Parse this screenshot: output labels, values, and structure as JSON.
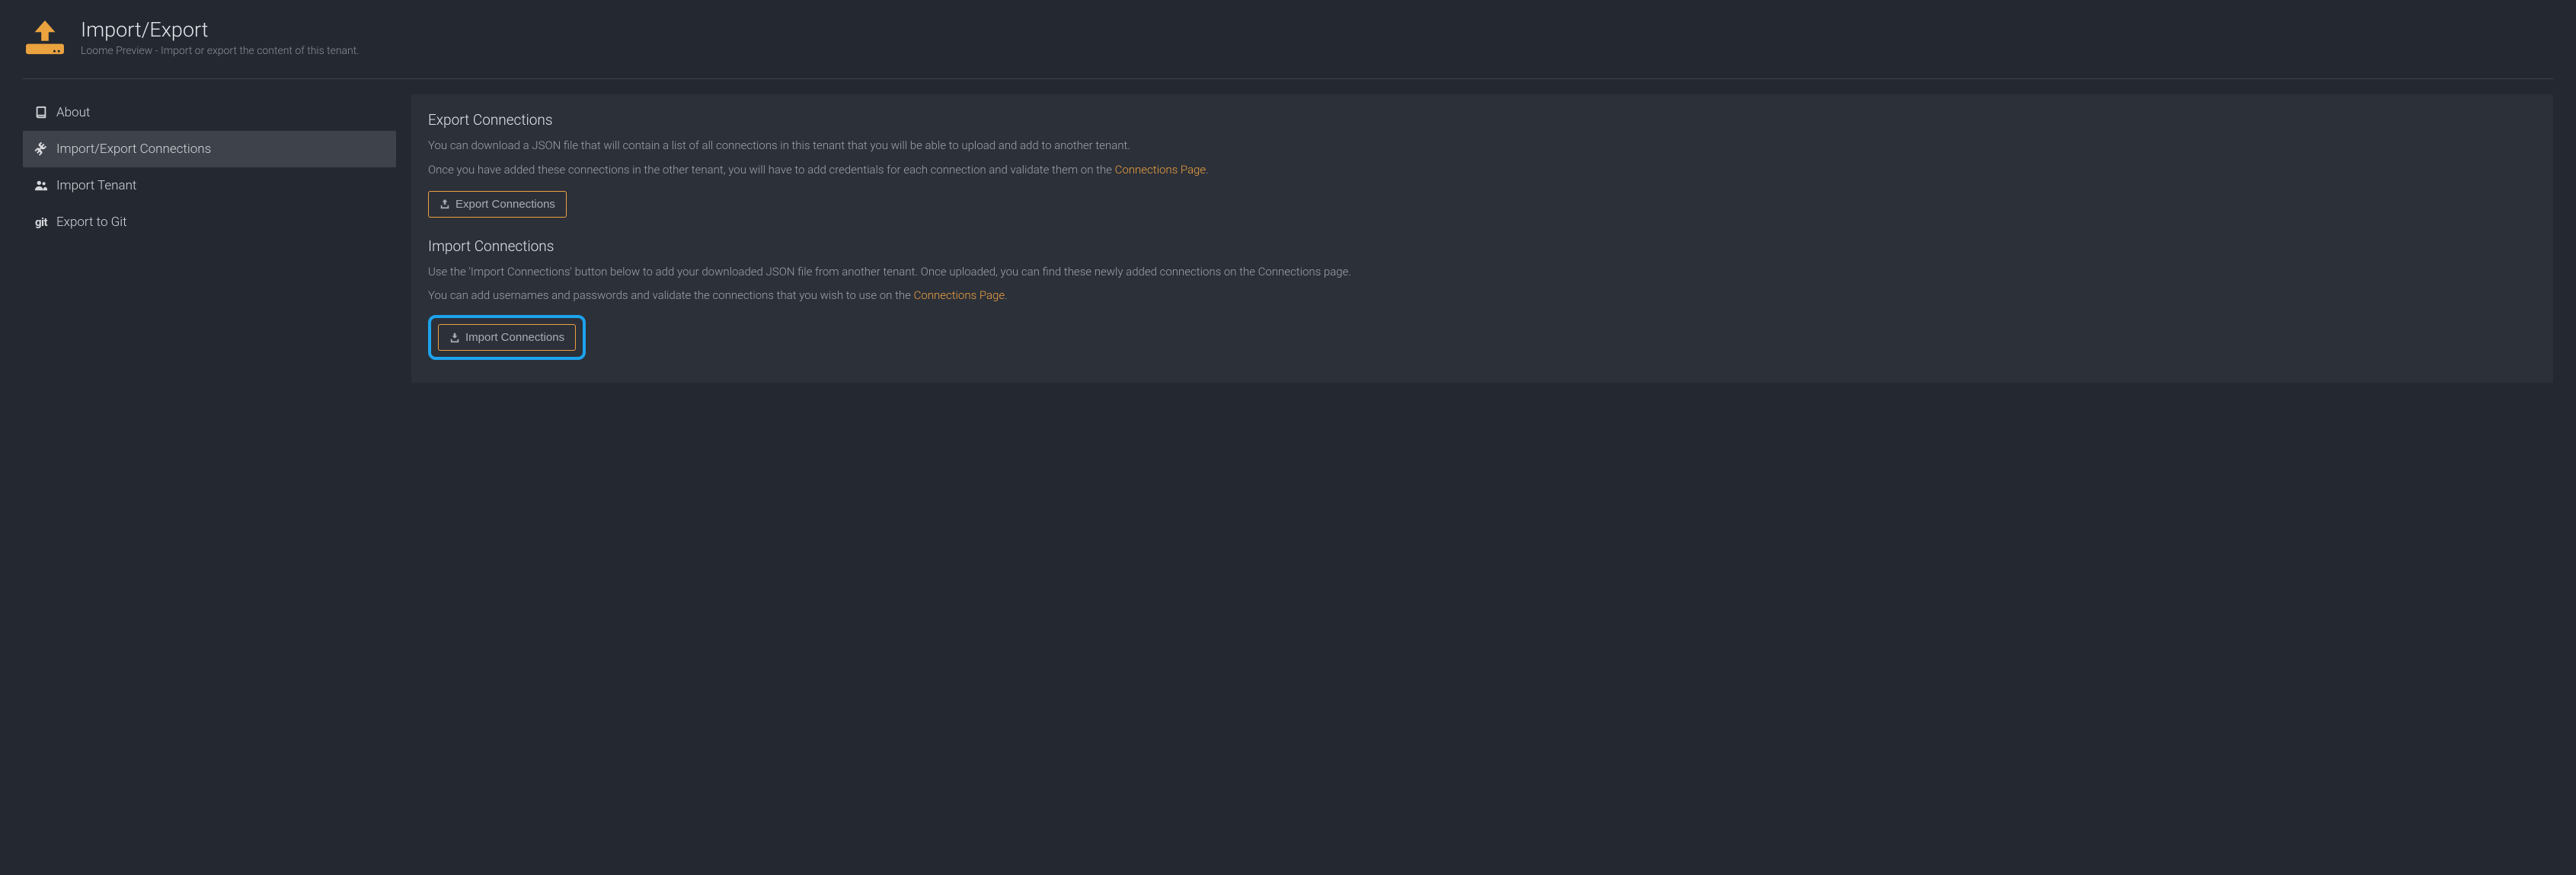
{
  "header": {
    "title": "Import/Export",
    "subtitle": "Loome Preview - Import or export the content of this tenant."
  },
  "sidebar": {
    "items": [
      {
        "label": "About"
      },
      {
        "label": "Import/Export Connections"
      },
      {
        "label": "Import Tenant"
      },
      {
        "label": "Export to Git"
      }
    ]
  },
  "content": {
    "export": {
      "heading": "Export Connections",
      "paragraph1": "You can download a JSON file that will contain a list of all connections in this tenant that you will be able to upload and add to another tenant.",
      "paragraph2_prefix": "Once you have added these connections in the other tenant, you will have to add credentials for each connection and validate them on the ",
      "link_text": "Connections Page",
      "paragraph2_suffix": ".",
      "button_label": "Export Connections"
    },
    "import": {
      "heading": "Import Connections",
      "paragraph1": "Use the 'Import Connections' button below to add your downloaded JSON file from another tenant. Once uploaded, you can find these newly added connections on the Connections page.",
      "paragraph2_prefix": "You can add usernames and passwords and validate the connections that you wish to use on the ",
      "link_text": "Connections Page",
      "paragraph2_suffix": ".",
      "button_label": "Import Connections"
    }
  }
}
